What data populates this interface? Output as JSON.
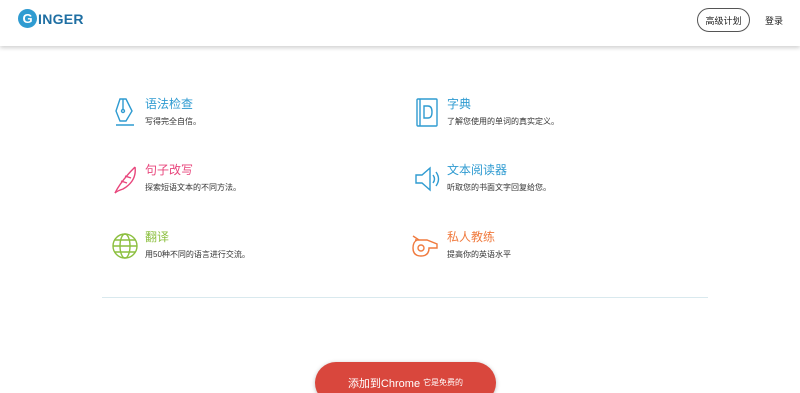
{
  "header": {
    "logo_letter": "G",
    "logo_text": "INGER",
    "plan_button": "高级计划",
    "login_link": "登录"
  },
  "features": [
    {
      "id": "grammar",
      "icon": "pen-nib-icon",
      "color": "#2f9bd1",
      "title": "语法检查",
      "desc": "写得完全自信。"
    },
    {
      "id": "dictionary",
      "icon": "dictionary-book-icon",
      "color": "#2f9bd1",
      "title": "字典",
      "desc": "了解您使用的单词的真实定义。"
    },
    {
      "id": "rephrase",
      "icon": "feather-icon",
      "color": "#e8467c",
      "title": "句子改写",
      "desc": "探索短语文本的不同方法。"
    },
    {
      "id": "reader",
      "icon": "speaker-icon",
      "color": "#2f9bd1",
      "title": "文本阅读器",
      "desc": "听取您的书面文字回复给您。"
    },
    {
      "id": "translate",
      "icon": "globe-icon",
      "color": "#8cbf3f",
      "title": "翻译",
      "desc": "用50种不同的语言进行交流。"
    },
    {
      "id": "coach",
      "icon": "whistle-icon",
      "color": "#f07a3e",
      "title": "私人教练",
      "desc": "提高你的英语水平"
    }
  ],
  "cta": {
    "main": "添加到Chrome",
    "sub": "它是免费的"
  }
}
